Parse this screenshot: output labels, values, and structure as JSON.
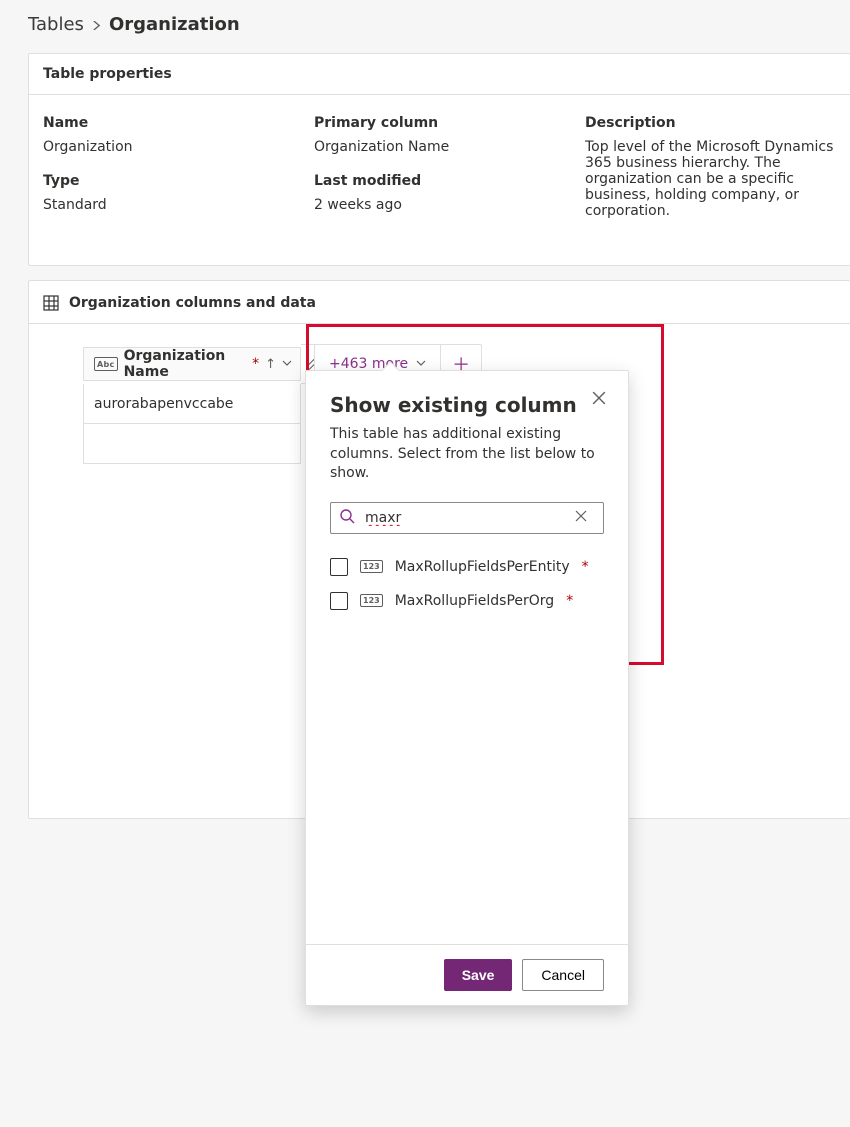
{
  "breadcrumb": {
    "root": "Tables",
    "current": "Organization"
  },
  "properties": {
    "title": "Table properties",
    "name_label": "Name",
    "name_value": "Organization",
    "type_label": "Type",
    "type_value": "Standard",
    "primary_label": "Primary column",
    "primary_value": "Organization Name",
    "modified_label": "Last modified",
    "modified_value": "2 weeks ago",
    "desc_label": "Description",
    "desc_value": "Top level of the Microsoft Dynamics 365 business hierarchy. The organization can be a specific business, holding company, or corporation."
  },
  "columns_section": {
    "title": "Organization columns and data",
    "header_column": "Organization Name",
    "row0_value": "aurorabapenvccabe",
    "more_label": "+463 more"
  },
  "popover": {
    "title": "Show existing column",
    "subtitle": "This table has additional existing columns. Select from the list below to show.",
    "search_value": "maxr",
    "options": [
      {
        "label": "MaxRollupFieldsPerEntity",
        "required": true
      },
      {
        "label": "MaxRollupFieldsPerOrg",
        "required": true
      }
    ],
    "save": "Save",
    "cancel": "Cancel"
  }
}
